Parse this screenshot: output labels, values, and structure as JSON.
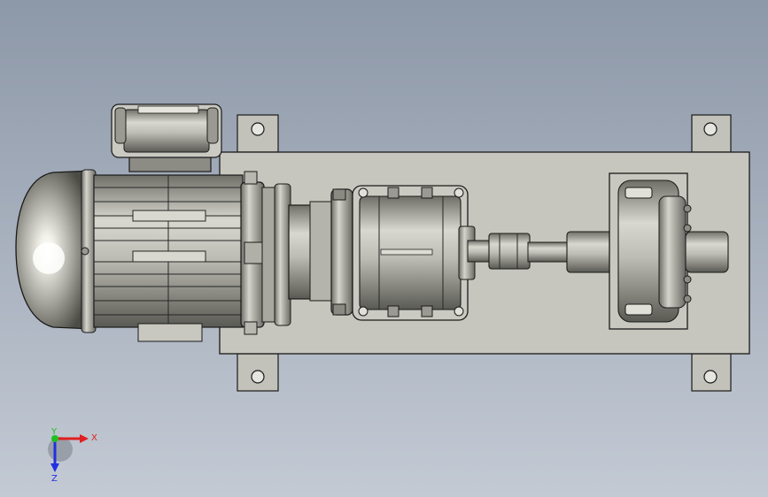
{
  "viewport": {
    "background_top": "#8d98a8",
    "background_bottom": "#c3cad4"
  },
  "model": {
    "part_color": "#c4c4bc",
    "edge_color": "#1a1a1a",
    "components": [
      "base-plate",
      "mounting-foot",
      "electric-motor",
      "terminal-box",
      "coupling-housing",
      "gear-reducer",
      "output-shaft",
      "pillow-block-bearing"
    ]
  },
  "triad": {
    "x_label": "X",
    "y_label": "Y",
    "z_label": "Z",
    "x_color": "#e02020",
    "y_color": "#20c020",
    "z_color": "#2030e0"
  }
}
